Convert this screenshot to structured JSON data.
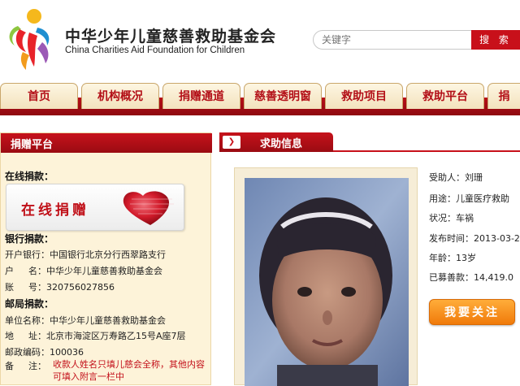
{
  "header": {
    "org_name_cn": "中华少年儿童慈善救助基金会",
    "org_name_en": "China Charities Aid Foundation for Children",
    "search_placeholder": "关键字",
    "search_button": "搜 索"
  },
  "nav": {
    "items": [
      {
        "label": "首页"
      },
      {
        "label": "机构概况"
      },
      {
        "label": "捐赠通道"
      },
      {
        "label": "慈善透明窗"
      },
      {
        "label": "救助项目"
      },
      {
        "label": "救助平台"
      },
      {
        "label": "捐"
      }
    ]
  },
  "left_panel": {
    "title": "捐赠平台",
    "online_label": "在线捐款：",
    "online_button": "在线捐赠",
    "bank_label": "银行捐款：",
    "bank_rows": [
      "开户银行：中国银行北京分行西翠路支行",
      "户 　 名：中华少年儿童慈善救助基金会",
      "账 　 号：320756027856"
    ],
    "post_label": "邮局捐款：",
    "post_rows": [
      "单位名称：中华少年儿童慈善救助基金会",
      "地 　 址：北京市海淀区万寿路乙15号A座7层",
      "邮政编码：100036"
    ],
    "note_prefix": "备 　 注：",
    "note_text": "收款人姓名只填儿慈会全称，其他内容可填入附言一栏中"
  },
  "right_panel": {
    "title": "求助信息",
    "arrow": "❯",
    "details": [
      "受助人：刘珊",
      "用途：儿童医疗救助",
      "状况：车祸",
      "发布时间：2013-03-2",
      "年龄：13岁",
      "已募善款：14,419.0"
    ],
    "follow_button": "我要关注"
  },
  "colors": {
    "brand_red": "#c8101a",
    "panel_bg": "#fdf3d9",
    "follow_orange": "#f07a0a"
  }
}
